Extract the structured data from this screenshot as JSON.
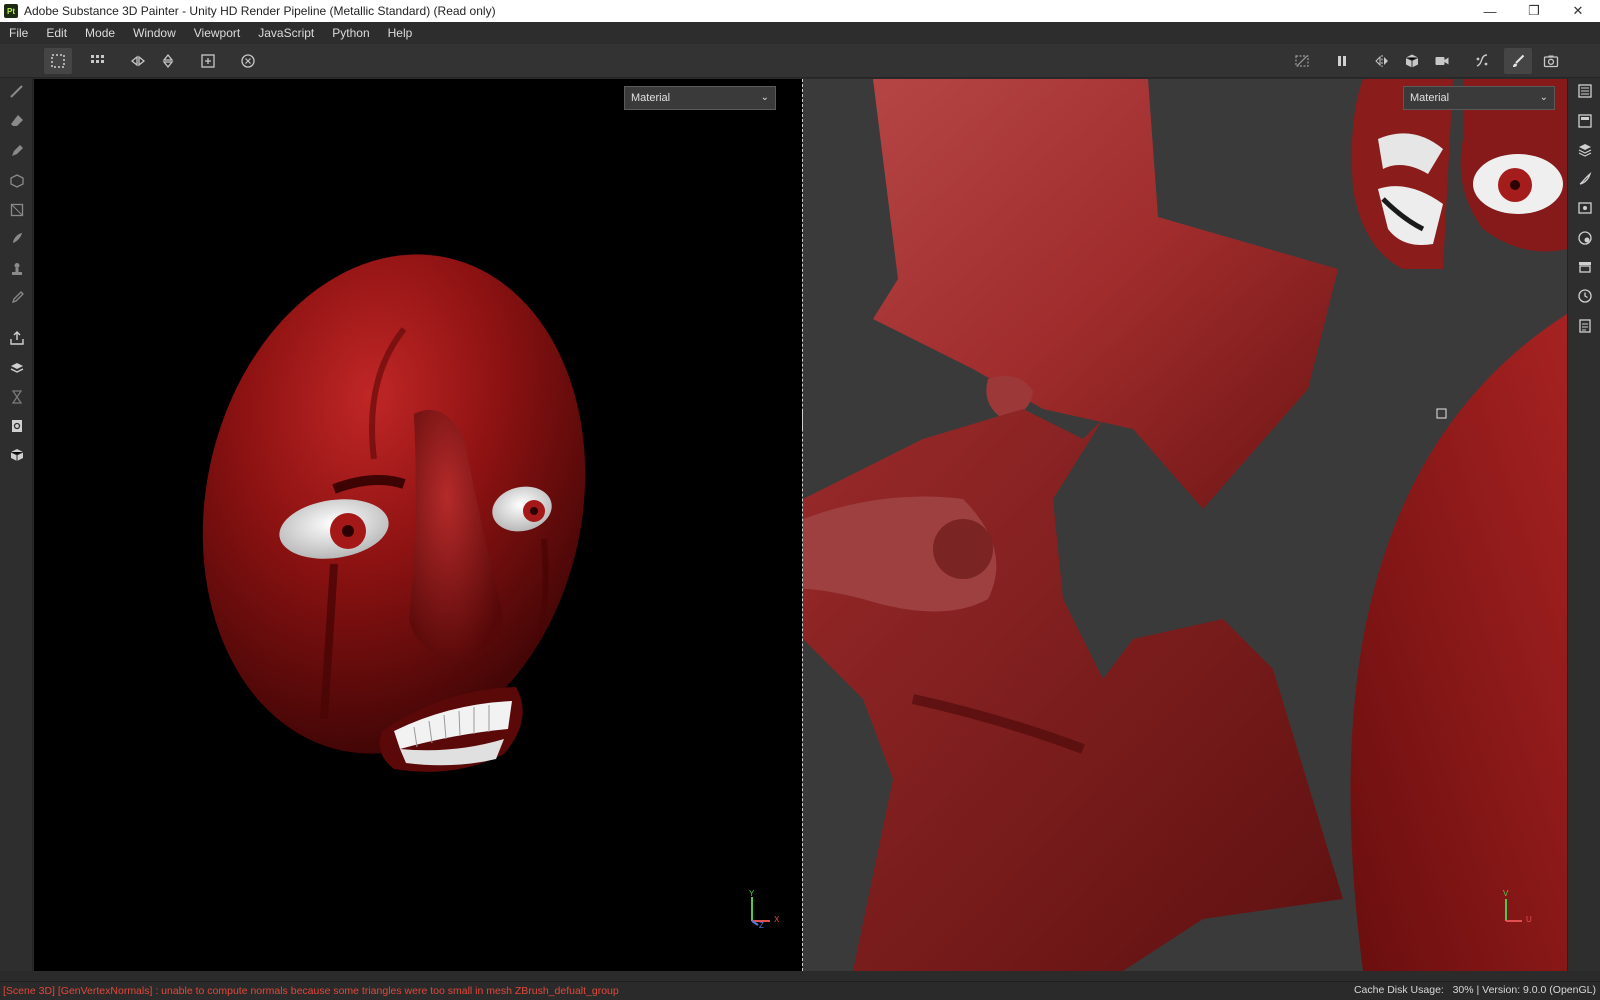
{
  "window": {
    "title": "Adobe Substance 3D Painter - Unity HD Render Pipeline (Metallic Standard) (Read only)",
    "app_badge": "Pt",
    "controls": {
      "minimize": "—",
      "restore": "❐",
      "close": "✕"
    }
  },
  "menu": [
    "File",
    "Edit",
    "Mode",
    "Window",
    "Viewport",
    "JavaScript",
    "Python",
    "Help"
  ],
  "toolbar": {
    "left_icons": [
      "layout-single-icon",
      "layout-grid-icon",
      "mirror-x-icon",
      "mirror-y-icon",
      "frame-selection-icon",
      "reset-camera-icon"
    ],
    "right_icons": [
      "hide-icon",
      "pause-icon",
      "symmetry-icon",
      "display-settings-icon",
      "camera-icon",
      "bake-icon",
      "paint-brush-icon",
      "screenshot-icon"
    ]
  },
  "viewport_3d": {
    "channel_dropdown": "Material",
    "axis_labels": {
      "y": "Y",
      "x": "X",
      "z": "Z"
    }
  },
  "viewport_2d": {
    "channel_dropdown": "Material",
    "axis_labels": {
      "v": "V",
      "u": "U"
    }
  },
  "status": {
    "message": "[Scene 3D] [GenVertexNormals] : unable to compute normals because some triangles were too small in mesh ZBrush_defualt_group",
    "cache_label": "Cache Disk Usage:",
    "cache_value": "30%",
    "version": "Version: 9.0.0 (OpenGL)"
  },
  "colors": {
    "accent_red": "#e2483a",
    "skin_dark": "#6e0d0d",
    "skin_mid": "#a31616",
    "skin_light": "#c84a4a"
  }
}
